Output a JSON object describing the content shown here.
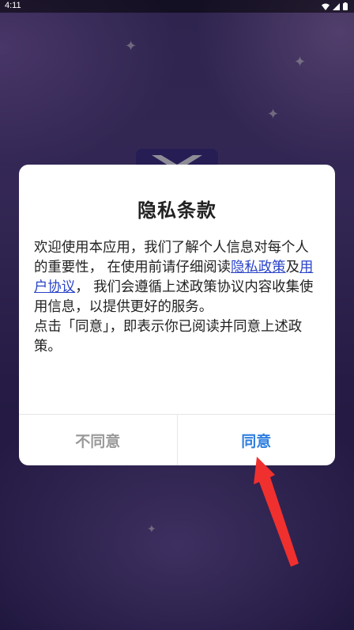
{
  "status_bar": {
    "time": "4:11"
  },
  "dialog": {
    "title": "隐私条款",
    "body": {
      "para1_part1": "欢迎使用本应用，我们了解个人信息对每个人的重要性， 在使用前请仔细阅读",
      "privacy_link": "隐私政策",
      "connector": "及",
      "user_agreement_link": "用户协议",
      "para1_part2": "， 我们会遵循上述政策协议内容收集使用信息，以提供更好的服务。",
      "para2": "点击「同意」，即表示你已阅读并同意上述政策。"
    },
    "buttons": {
      "disagree": "不同意",
      "agree": "同意"
    }
  },
  "colors": {
    "link": "#2a43c8",
    "agree": "#2f7fe0",
    "disagree": "#9a9a9a",
    "annotation_arrow": "#f0302e"
  },
  "icons": [
    "wifi-icon",
    "signal-icon",
    "battery-icon",
    "app-logo-icon",
    "sparkle-icon",
    "red-pointer-arrow"
  ]
}
